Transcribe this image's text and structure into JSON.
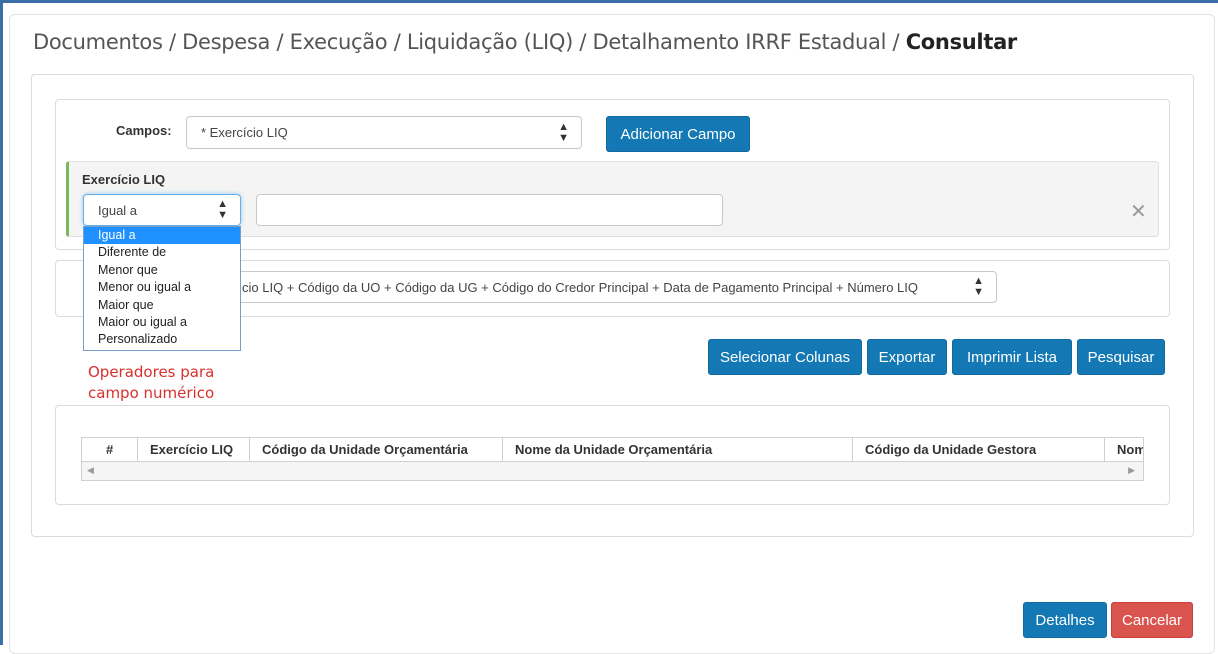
{
  "breadcrumb": {
    "path": "Documentos / Despesa / Execução / Liquidação (LIQ) / Detalhamento IRRF Estadual / ",
    "current": "Consultar"
  },
  "filter": {
    "campos_label": "Campos:",
    "campos_selected": "* Exercício LIQ",
    "add_field_label": "Adicionar Campo",
    "field_label": "Exercício LIQ",
    "operator_selected": "Igual a",
    "value": "",
    "operator_options": [
      "Igual a",
      "Diferente de",
      "Menor que",
      "Menor ou igual a",
      "Maior que",
      "Maior ou igual a",
      "Personalizado"
    ],
    "remove_icon": "close-icon"
  },
  "order": {
    "visible_text": "cio LIQ + Código da UO + Código da UG + Código do Credor Principal + Data de Pagamento Principal + Número LIQ"
  },
  "annotation": {
    "line1": "Operadores para",
    "line2": "campo numérico"
  },
  "toolbar": {
    "select_columns_label": "Selecionar Colunas",
    "export_label": "Exportar",
    "print_label": "Imprimir Lista",
    "search_label": "Pesquisar"
  },
  "grid": {
    "columns": [
      "#",
      "Exercício LIQ",
      "Código da Unidade Orçamentária",
      "Nome da Unidade Orçamentária",
      "Código da Unidade Gestora",
      "Nom"
    ]
  },
  "footer": {
    "details_label": "Detalhes",
    "cancel_label": "Cancelar"
  },
  "colors": {
    "primary": "#1378b4",
    "danger": "#d9534f",
    "note": "#d9302c",
    "highlight": "#1e90ff",
    "field_accent": "#7bb661"
  }
}
